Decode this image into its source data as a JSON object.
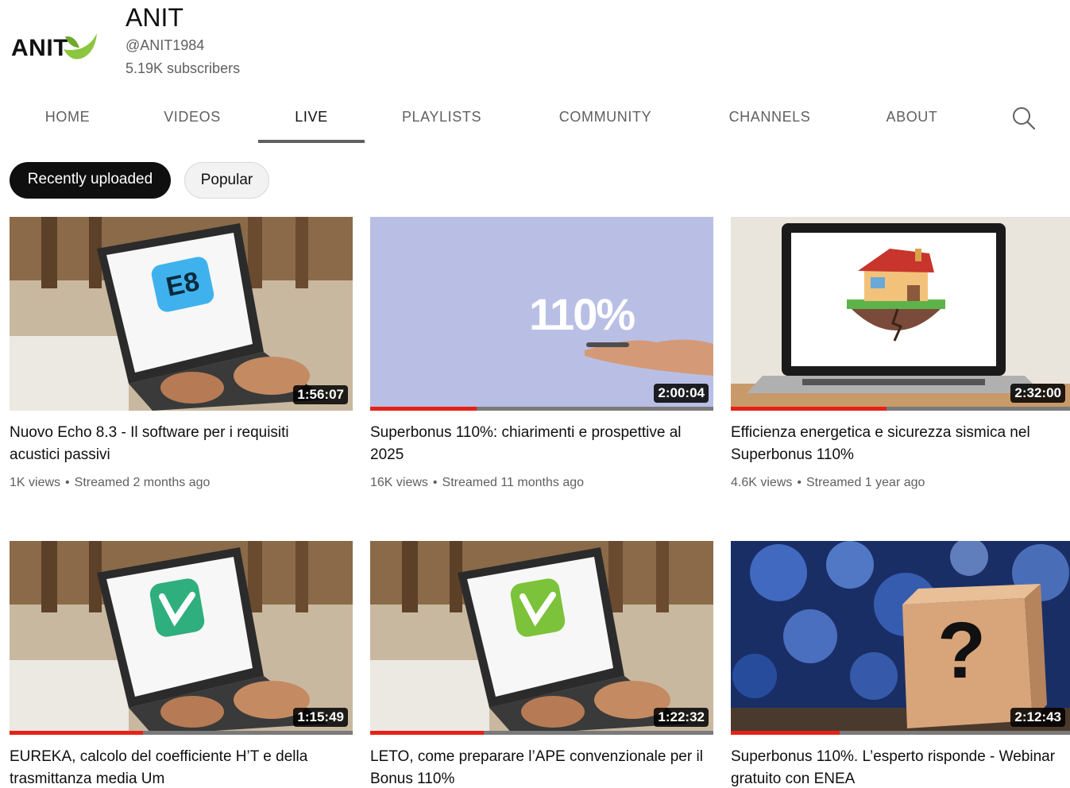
{
  "channel": {
    "logo_text": "ANIT",
    "name": "ANIT",
    "handle": "@ANIT1984",
    "subscribers": "5.19K subscribers"
  },
  "tabs": [
    {
      "label": "HOME"
    },
    {
      "label": "VIDEOS"
    },
    {
      "label": "LIVE"
    },
    {
      "label": "PLAYLISTS"
    },
    {
      "label": "COMMUNITY"
    },
    {
      "label": "CHANNELS"
    },
    {
      "label": "ABOUT"
    }
  ],
  "active_tab": "LIVE",
  "chips": {
    "active": "Recently uploaded",
    "inactive": "Popular"
  },
  "videos": [
    {
      "title": "Nuovo Echo 8.3 - Il software per i requisiti acustici passivi",
      "views": "1K views",
      "streamed": "Streamed 2 months ago",
      "duration": "1:56:07",
      "watched_fraction": 0,
      "thumbnail_icon": "E8",
      "thumbnail_icon_name": "echo-app-icon"
    },
    {
      "title": "Superbonus 110%: chiarimenti e prospettive al 2025",
      "views": "16K views",
      "streamed": "Streamed 11 months ago",
      "duration": "2:00:04",
      "watched_fraction": 0.31,
      "thumbnail_text": "110%",
      "thumbnail_icon_name": "hand-110-percent-graphic"
    },
    {
      "title": "Efficienza energetica e sicurezza sismica nel Superbonus 110%",
      "views": "4.6K views",
      "streamed": "Streamed 1 year ago",
      "duration": "2:32:00",
      "watched_fraction": 0.46,
      "thumbnail_icon_name": "house-on-cracked-ground-icon"
    },
    {
      "title": "EUREKA, calcolo del coefficiente H’T e della trasmittanza media Um",
      "views": "",
      "streamed": "",
      "duration": "1:15:49",
      "watched_fraction": 0.39,
      "thumbnail_icon_name": "eureka-app-icon"
    },
    {
      "title": "LETO, come preparare l’APE convenzionale per il Bonus 110%",
      "views": "",
      "streamed": "",
      "duration": "1:22:32",
      "watched_fraction": 0.33,
      "thumbnail_icon_name": "leto-app-icon"
    },
    {
      "title": "Superbonus 110%. L’esperto risponde - Webinar gratuito con ENEA",
      "views": "",
      "streamed": "",
      "duration": "2:12:43",
      "watched_fraction": 0.32,
      "thumbnail_text": "?",
      "thumbnail_icon_name": "question-mark-cube-graphic"
    }
  ],
  "colors": {
    "progress": "#e62117",
    "brand_green": "#8cc63f",
    "chip_active_bg": "#0f0f0f"
  }
}
